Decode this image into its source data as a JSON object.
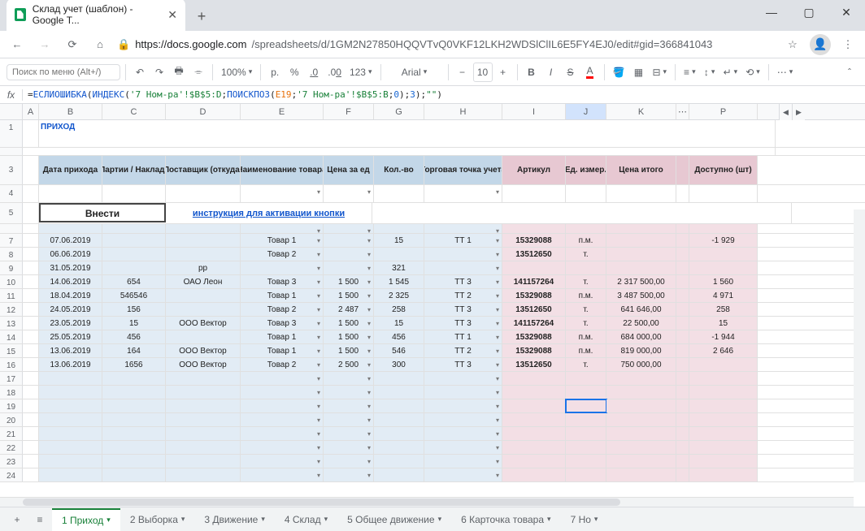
{
  "browser": {
    "tab_title": "Склад учет (шаблон) - Google Т...",
    "url_host": "https://docs.google.com",
    "url_path": "/spreadsheets/d/1GM2N27850HQQVTvQ0VKF12LKH2WDSlClIL6E5FY4EJ0/edit#gid=366841043"
  },
  "toolbar": {
    "search_placeholder": "Поиск по меню (Alt+/)",
    "zoom": "100%",
    "currency": "р.",
    "percent": "%",
    "dec_dec": ".0←",
    "dec_inc": ".00",
    "num_fmt": "123",
    "font": "Arial",
    "font_size": "10"
  },
  "formula": {
    "prefix": "=",
    "f1": "ЕСЛИОШИБКА",
    "f2": "ИНДЕКС",
    "s1": "'7 Ном-ра'!$B$5:D",
    "f3": "ПОИСКПОЗ",
    "ref1": "E19",
    "s2": "'7 Ном-ра'!$B$5:B",
    "n1": "0",
    "n2": "3",
    "s3": "\"\""
  },
  "col_labels": [
    "A",
    "B",
    "C",
    "D",
    "E",
    "F",
    "G",
    "H",
    "I",
    "J",
    "K",
    "P"
  ],
  "title": "ПРИХОД",
  "row_numbers": [
    "1",
    "",
    "3",
    "4",
    "5",
    "",
    "7",
    "8",
    "9",
    "10",
    "11",
    "12",
    "13",
    "14",
    "15",
    "16",
    "17",
    "18",
    "19",
    "20",
    "21",
    "22",
    "23",
    "24"
  ],
  "headers": {
    "b": "Дата прихода",
    "c": "№ Партии / Накладной",
    "d": "Поставщик (откуда)",
    "e": "Наименование товара",
    "f": "Цена за ед",
    "g": "Кол.-во",
    "h": "Торговая точка учета",
    "i": "Артикул",
    "j": "Ед. измер.",
    "k": "Цена итого",
    "p": "Доступно (шт)"
  },
  "enter_btn": "Внести",
  "instr_link": "инструкция для активации кнопки",
  "rows": [
    {
      "b": "07.06.2019",
      "c": "",
      "d": "",
      "e": "Товар 1",
      "f": "",
      "g": "15",
      "h": "ТТ 1",
      "i": "15329088",
      "j": "п.м.",
      "k": "",
      "p": "-1 929"
    },
    {
      "b": "06.06.2019",
      "c": "",
      "d": "",
      "e": "Товар 2",
      "f": "",
      "g": "",
      "h": "",
      "i": "13512650",
      "j": "т.",
      "k": "",
      "p": ""
    },
    {
      "b": "31.05.2019",
      "c": "",
      "d": "рр",
      "e": "",
      "f": "",
      "g": "321",
      "h": "",
      "i": "",
      "j": "",
      "k": "",
      "p": ""
    },
    {
      "b": "14.06.2019",
      "c": "654",
      "d": "ОАО Леон",
      "e": "Товар 3",
      "f": "1 500",
      "g": "1 545",
      "h": "ТТ 3",
      "i": "141157264",
      "j": "т.",
      "k": "2 317 500,00",
      "p": "1 560"
    },
    {
      "b": "18.04.2019",
      "c": "546546",
      "d": "",
      "e": "Товар 1",
      "f": "1 500",
      "g": "2 325",
      "h": "ТТ 2",
      "i": "15329088",
      "j": "п.м.",
      "k": "3 487 500,00",
      "p": "4 971"
    },
    {
      "b": "24.05.2019",
      "c": "156",
      "d": "",
      "e": "Товар 2",
      "f": "2 487",
      "g": "258",
      "h": "ТТ 3",
      "i": "13512650",
      "j": "т.",
      "k": "641 646,00",
      "p": "258"
    },
    {
      "b": "23.05.2019",
      "c": "15",
      "d": "ООО Вектор",
      "e": "Товар 3",
      "f": "1 500",
      "g": "15",
      "h": "ТТ 3",
      "i": "141157264",
      "j": "т.",
      "k": "22 500,00",
      "p": "15"
    },
    {
      "b": "25.05.2019",
      "c": "456",
      "d": "",
      "e": "Товар 1",
      "f": "1 500",
      "g": "456",
      "h": "ТТ 1",
      "i": "15329088",
      "j": "п.м.",
      "k": "684 000,00",
      "p": "-1 944"
    },
    {
      "b": "13.06.2019",
      "c": "164",
      "d": "ООО Вектор",
      "e": "Товар 1",
      "f": "1 500",
      "g": "546",
      "h": "ТТ 2",
      "i": "15329088",
      "j": "п.м.",
      "k": "819 000,00",
      "p": "2 646"
    },
    {
      "b": "13.06.2019",
      "c": "1656",
      "d": "ООО Вектор",
      "e": "Товар 2",
      "f": "2 500",
      "g": "300",
      "h": "ТТ 3",
      "i": "13512650",
      "j": "т.",
      "k": "750 000,00",
      "p": ""
    }
  ],
  "sheet_tabs": [
    "1 Приход",
    "2 Выборка",
    "3 Движение",
    "4 Склад",
    "5 Общее движение",
    "6 Карточка товара",
    "7 Но"
  ]
}
